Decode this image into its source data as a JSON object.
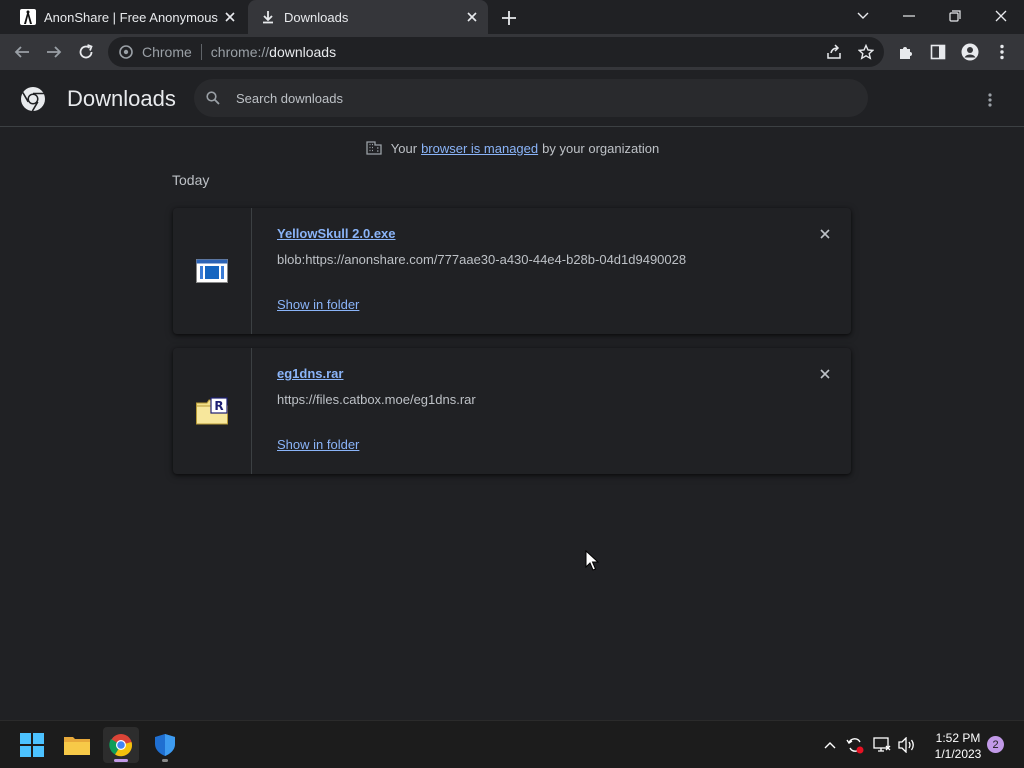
{
  "tabs": [
    {
      "title": "AnonShare | Free Anonymous File Sharing"
    },
    {
      "title": "Downloads"
    }
  ],
  "omnibox": {
    "chip": "Chrome",
    "url_scheme": "chrome://",
    "url_host": "downloads"
  },
  "page": {
    "title": "Downloads",
    "search_placeholder": "Search downloads",
    "managed_prefix": "Your",
    "managed_link": "browser is managed",
    "managed_suffix": "by your organization",
    "section_label": "Today"
  },
  "downloads": [
    {
      "file_name": "YellowSkull 2.0.exe",
      "url": "blob:https://anonshare.com/777aae30-a430-44e4-b28b-04d1d9490028",
      "action": "Show in folder",
      "icon": "exe-file-icon"
    },
    {
      "file_name": "eg1dns.rar",
      "url": "https://files.catbox.moe/eg1dns.rar",
      "action": "Show in folder",
      "icon": "rar-file-icon"
    }
  ],
  "taskbar": {
    "time": "1:52 PM",
    "date": "1/1/2023",
    "notifications": "2"
  },
  "colors": {
    "background": "#202124",
    "toolbar": "#35363a",
    "link": "#8ab4f8",
    "secondary_text": "#bdc1c6"
  }
}
